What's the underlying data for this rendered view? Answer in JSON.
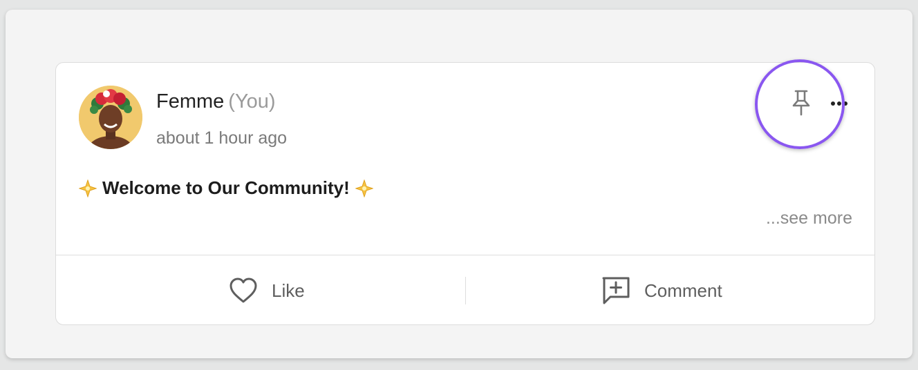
{
  "post": {
    "author": "Femme",
    "author_tag": "(You)",
    "timestamp": "about 1 hour ago",
    "content": "Welcome to Our Community!",
    "content_prefix_icon": "sparkle-star-icon",
    "content_suffix_icon": "sparkle-star-icon",
    "see_more": "...see more"
  },
  "actions": {
    "like_label": "Like",
    "like_icon": "heart-icon",
    "comment_label": "Comment",
    "comment_icon": "comment-add-icon"
  },
  "header_icons": {
    "pin": "pin-icon",
    "more": "more-icon"
  },
  "colors": {
    "highlight": "#8a57f0",
    "avatar_bg": "#f1c96d",
    "text_primary": "#222222",
    "text_secondary": "#7a7a7a"
  }
}
